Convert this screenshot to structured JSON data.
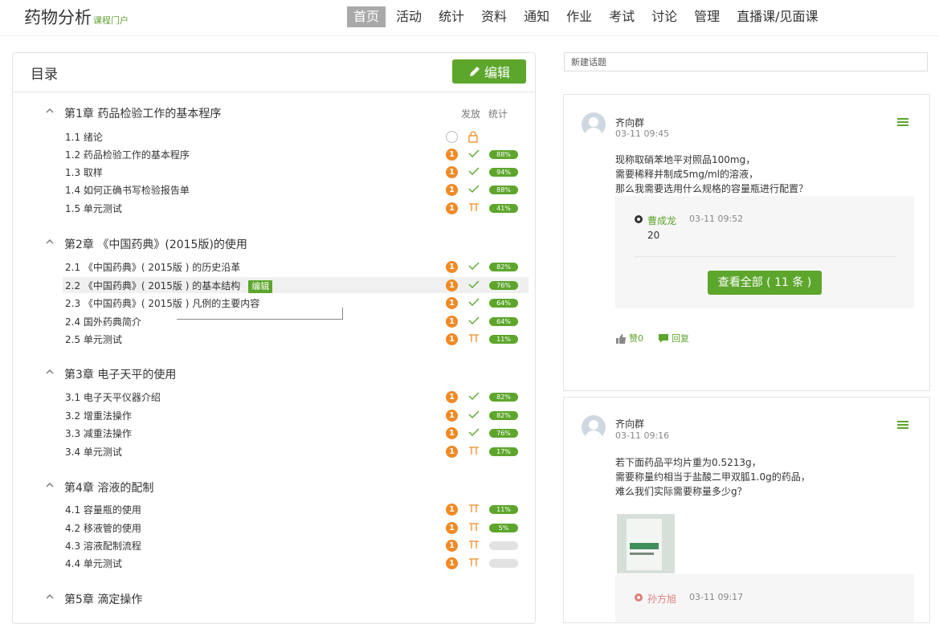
{
  "header": {
    "brand_title": "药物分析",
    "brand_sub": "课程门户",
    "nav": [
      "首页",
      "活动",
      "统计",
      "资料",
      "通知",
      "作业",
      "考试",
      "讨论",
      "管理",
      "直播课/见面课"
    ],
    "active_nav": "首页"
  },
  "toc": {
    "title": "目录",
    "edit_label": "编辑",
    "col_publish": "发放",
    "col_stats": "统计",
    "chapters": [
      {
        "title": "第1章 药品检验工作的基本程序",
        "sections": [
          {
            "title": "1.1 绪论",
            "badge": "",
            "status": "lock",
            "pct": ""
          },
          {
            "title": "1.2 药品检验工作的基本程序",
            "badge": "1",
            "status": "check",
            "pct": "88%"
          },
          {
            "title": "1.3 取样",
            "badge": "1",
            "status": "check",
            "pct": "94%"
          },
          {
            "title": "1.4 如何正确书写检验报告单",
            "badge": "1",
            "status": "check",
            "pct": "88%"
          },
          {
            "title": "1.5 单元测试",
            "badge": "1",
            "status": "test",
            "pct": "41%"
          }
        ]
      },
      {
        "title": "第2章 《中国药典》(2015版)的使用",
        "sections": [
          {
            "title": "2.1 《中国药典》( 2015版 ) 的历史沿革",
            "badge": "1",
            "status": "check",
            "pct": "82%"
          },
          {
            "title": "2.2 《中国药典》( 2015版 ) 的基本结构",
            "badge": "1",
            "status": "check",
            "pct": "76%",
            "tag": "编辑"
          },
          {
            "title": "2.3 《中国药典》( 2015版 ) 凡例的主要内容",
            "badge": "1",
            "status": "check",
            "pct": "64%"
          },
          {
            "title": "2.4 国外药典简介",
            "badge": "1",
            "status": "check",
            "pct": "64%"
          },
          {
            "title": "2.5 单元测试",
            "badge": "1",
            "status": "test",
            "pct": "11%"
          }
        ]
      },
      {
        "title": "第3章 电子天平的使用",
        "sections": [
          {
            "title": "3.1 电子天平仪器介绍",
            "badge": "1",
            "status": "check",
            "pct": "82%"
          },
          {
            "title": "3.2 增重法操作",
            "badge": "1",
            "status": "check",
            "pct": "82%"
          },
          {
            "title": "3.3 减重法操作",
            "badge": "1",
            "status": "check",
            "pct": "76%"
          },
          {
            "title": "3.4 单元测试",
            "badge": "1",
            "status": "test",
            "pct": "17%"
          }
        ]
      },
      {
        "title": "第4章 溶液的配制",
        "sections": [
          {
            "title": "4.1 容量瓶的使用",
            "badge": "1",
            "status": "test",
            "pct": "11%"
          },
          {
            "title": "4.2 移液管的使用",
            "badge": "1",
            "status": "test",
            "pct": "5%"
          },
          {
            "title": "4.3 溶液配制流程",
            "badge": "1",
            "status": "test",
            "pct": ""
          },
          {
            "title": "4.4 单元测试",
            "badge": "1",
            "status": "test",
            "pct": ""
          }
        ]
      },
      {
        "title": "第5章 滴定操作",
        "sections": []
      }
    ]
  },
  "discussion": {
    "new_topic_placeholder": "新建话题",
    "posts": [
      {
        "author": "齐向群",
        "time": "03-11 09:45",
        "lines": [
          "现称取硝苯地平对照品100mg，",
          "需要稀释并制成5mg/ml的溶液，",
          "那么我需要选用什么规格的容量瓶进行配置？"
        ],
        "reply": {
          "author": "曹成龙",
          "time": "03-11 09:52",
          "text": "20"
        },
        "view_all": "查看全部 ( 11 条 )",
        "like": "赞0",
        "reply_label": "回复"
      },
      {
        "author": "齐向群",
        "time": "03-11 09:16",
        "lines": [
          "若下面药品平均片重为0.5213g，",
          "需要称量约相当于盐酸二甲双胍1.0g的药品，",
          "难么我们实际需要称量多少g？"
        ],
        "reply": {
          "author": "孙方旭",
          "time": "03-11 09:17"
        }
      }
    ]
  },
  "colors": {
    "accent": "#5da62c",
    "badge": "#f08a24"
  }
}
